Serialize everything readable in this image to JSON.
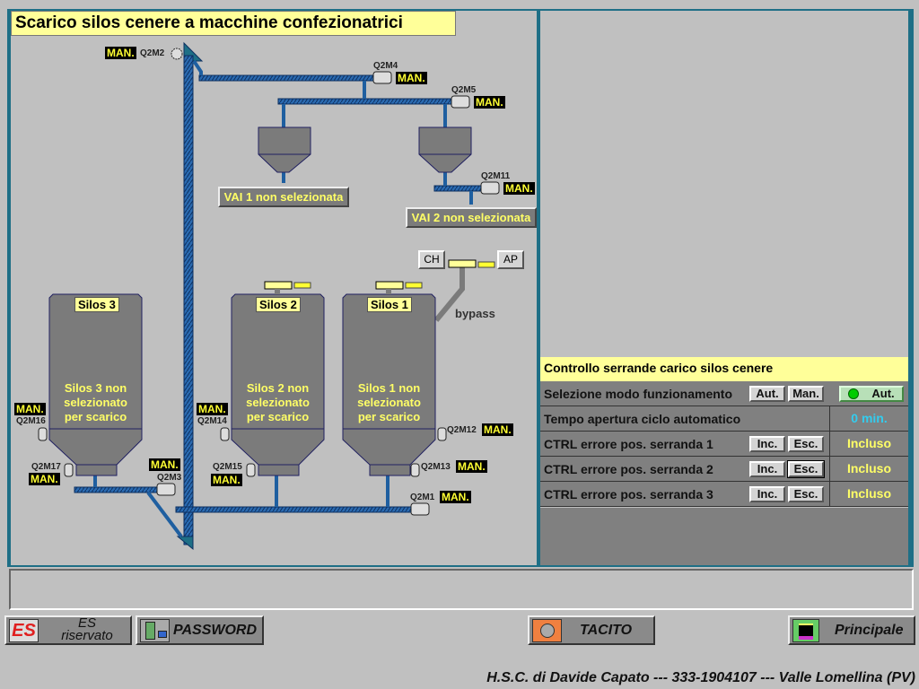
{
  "title": "Scarico silos cenere a macchine confezionatrici",
  "man_label": "MAN.",
  "motors": {
    "q2m1": "Q2M1",
    "q2m2": "Q2M2",
    "q2m3": "Q2M3",
    "q2m4": "Q2M4",
    "q2m5": "Q2M5",
    "q2m11": "Q2M11",
    "q2m12": "Q2M12",
    "q2m13": "Q2M13",
    "q2m14": "Q2M14",
    "q2m15": "Q2M15",
    "q2m16": "Q2M16",
    "q2m17": "Q2M17"
  },
  "vai": [
    "VAI 1 non selezionata",
    "VAI 2 non selezionata"
  ],
  "silos": [
    {
      "label": "Silos 3",
      "status": [
        "Silos 3 non",
        "selezionato",
        "per scarico"
      ]
    },
    {
      "label": "Silos 2",
      "status": [
        "Silos 2 non",
        "selezionato",
        "per scarico"
      ]
    },
    {
      "label": "Silos 1",
      "status": [
        "Silos 1 non",
        "selezionato",
        "per scarico"
      ]
    }
  ],
  "bypass": {
    "label": "bypass",
    "close": "CH",
    "open": "AP"
  },
  "control": {
    "header": "Controllo serrande carico silos cenere",
    "mode": {
      "label": "Selezione modo funzionamento",
      "aut": "Aut.",
      "man": "Man.",
      "state": "Aut."
    },
    "time": {
      "label": "Tempo apertura ciclo automatico",
      "value": "0 min."
    },
    "rows": [
      {
        "label": "CTRL errore pos. serranda 1",
        "inc": "Inc.",
        "esc": "Esc.",
        "value": "Incluso"
      },
      {
        "label": "CTRL errore pos. serranda 2",
        "inc": "Inc.",
        "esc": "Esc.",
        "value": "Incluso"
      },
      {
        "label": "CTRL errore pos. serranda 3",
        "inc": "Inc.",
        "esc": "Esc.",
        "value": "Incluso"
      }
    ]
  },
  "toolbar": {
    "es_icon": "ES",
    "es_line1": "ES",
    "es_line2": "riservato",
    "password": "PASSWORD",
    "tacito": "TACITO",
    "principale": "Principale"
  },
  "footer": "H.S.C. di Davide Capato --- 333-1904107 --- Valle Lomellina (PV)",
  "colors": {
    "pipe": "#1f5fa0",
    "frame": "#1e6f86",
    "silo": "#7b7b7b",
    "man_bg": "#000000",
    "man_fg": "#ffff33",
    "status_ok": "#00cc00"
  }
}
